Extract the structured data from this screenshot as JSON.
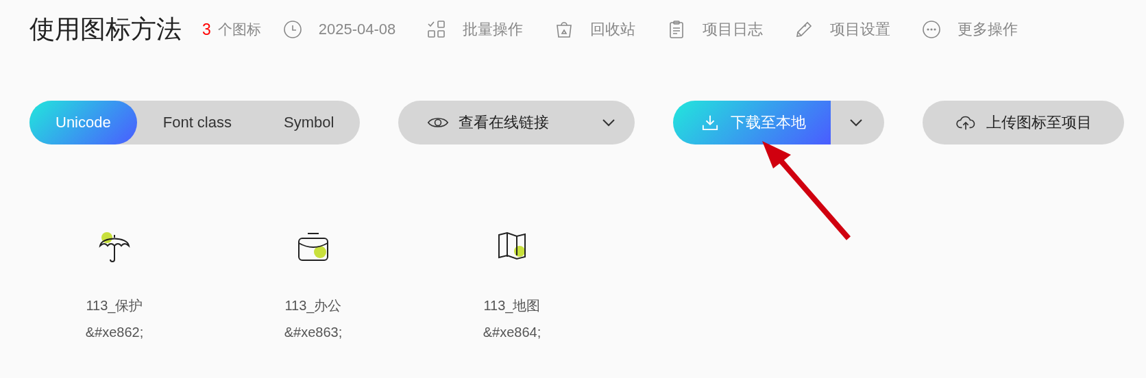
{
  "title": "使用图标方法",
  "count": {
    "value": "3",
    "label": "个图标"
  },
  "toolbar": [
    {
      "kind": "date",
      "label": "2025-04-08"
    },
    {
      "kind": "batch",
      "label": "批量操作"
    },
    {
      "kind": "trash",
      "label": "回收站"
    },
    {
      "kind": "log",
      "label": "项目日志"
    },
    {
      "kind": "settings",
      "label": "项目设置"
    },
    {
      "kind": "more",
      "label": "更多操作"
    }
  ],
  "modes": [
    {
      "label": "Unicode",
      "selected": true
    },
    {
      "label": "Font class",
      "selected": false
    },
    {
      "label": "Symbol",
      "selected": false
    }
  ],
  "view_link": {
    "label": "查看在线链接"
  },
  "download": {
    "label": "下载至本地"
  },
  "upload": {
    "label": "上传图标至项目"
  },
  "icons": [
    {
      "kind": "umbrella",
      "name": "113_保护",
      "code": "&#xe862;"
    },
    {
      "kind": "bag",
      "name": "113_办公",
      "code": "&#xe863;"
    },
    {
      "kind": "map",
      "name": "113_地图",
      "code": "&#xe864;"
    }
  ]
}
